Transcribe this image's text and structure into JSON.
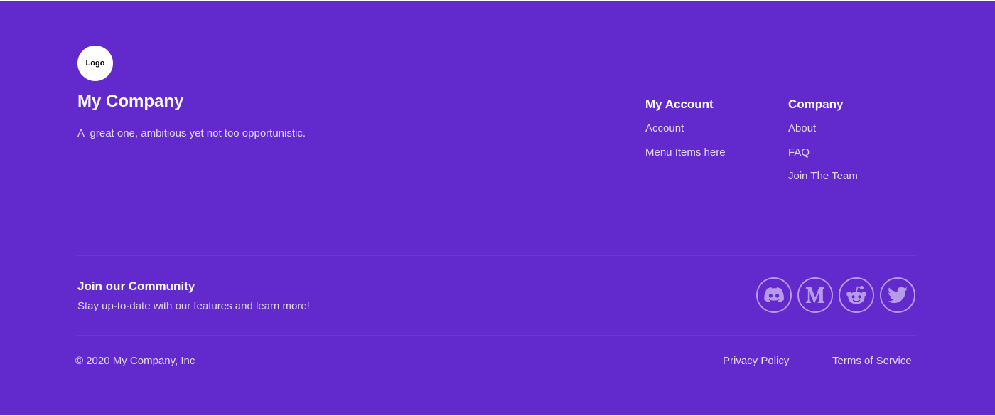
{
  "brand": {
    "logo_text": "Logo",
    "name": "My Company",
    "tagline": "A  great one, ambitious yet not too opportunistic."
  },
  "nav": {
    "columns": [
      {
        "heading": "My Account",
        "links": [
          "Account",
          "Menu Items here"
        ]
      },
      {
        "heading": "Company",
        "links": [
          "About",
          "FAQ",
          "Join The Team"
        ]
      }
    ]
  },
  "community": {
    "title": "Join our Community",
    "subtitle": "Stay up-to-date with our features and learn more!",
    "socials": [
      {
        "icon": "discord-icon"
      },
      {
        "icon": "medium-icon"
      },
      {
        "icon": "reddit-icon"
      },
      {
        "icon": "twitter-icon"
      }
    ]
  },
  "bottom": {
    "copyright": "© 2020 My Company, Inc",
    "privacy": "Privacy Policy",
    "terms": "Terms of Service"
  },
  "colors": {
    "background": "#6229cc",
    "text_muted": "#e2d8f6",
    "icon_tint": "#b79ae9"
  }
}
